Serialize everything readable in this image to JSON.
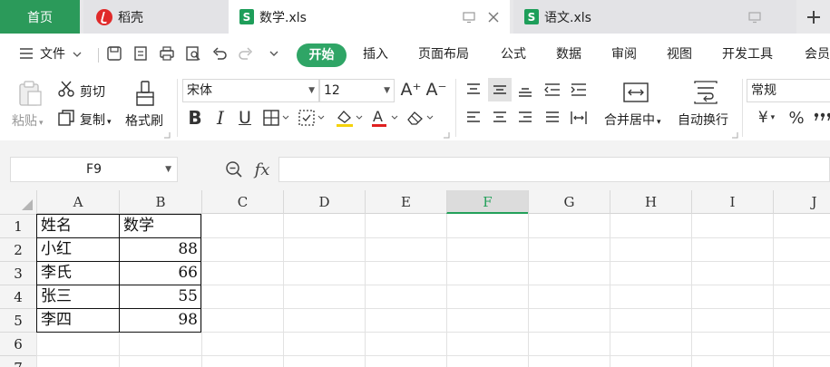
{
  "tabs": {
    "home": "首页",
    "daoke": "稻壳",
    "active_file": "数学.xls",
    "other_file": "语文.xls",
    "file_icon_letter": "S"
  },
  "menu": {
    "file_label": "文件",
    "items": [
      "开始",
      "插入",
      "页面布局",
      "公式",
      "数据",
      "审阅",
      "视图",
      "开发工具",
      "会员"
    ]
  },
  "ribbon": {
    "paste": "粘贴",
    "cut": "剪切",
    "copy": "复制",
    "format_painter": "格式刷",
    "font_name": "宋体",
    "font_size": "12",
    "merge_center": "合并居中",
    "auto_wrap": "自动换行",
    "number_format": "常规",
    "currency_symbol": "¥",
    "percent_symbol": "%",
    "grow_font": "A⁺",
    "shrink_font": "A⁻"
  },
  "formula_bar": {
    "cell_ref": "F9",
    "fx": "fx",
    "value": ""
  },
  "sheet": {
    "columns": [
      "A",
      "B",
      "C",
      "D",
      "E",
      "F",
      "G",
      "H",
      "I",
      "J"
    ],
    "active_column": "F",
    "rows": [
      "1",
      "2",
      "3",
      "4",
      "5",
      "6",
      "7"
    ],
    "header": [
      "姓名",
      "数学"
    ],
    "data": [
      {
        "name": "小红",
        "score": "88"
      },
      {
        "name": "李氏",
        "score": "66"
      },
      {
        "name": "张三",
        "score": "55"
      },
      {
        "name": "李四",
        "score": "98"
      }
    ]
  },
  "colors": {
    "accent": "#2fa566",
    "home_tab": "#2b9a5a",
    "daoke_logo": "#e02a2a",
    "highlight_fill": "#f5d20a",
    "font_color_red": "#e02020"
  }
}
